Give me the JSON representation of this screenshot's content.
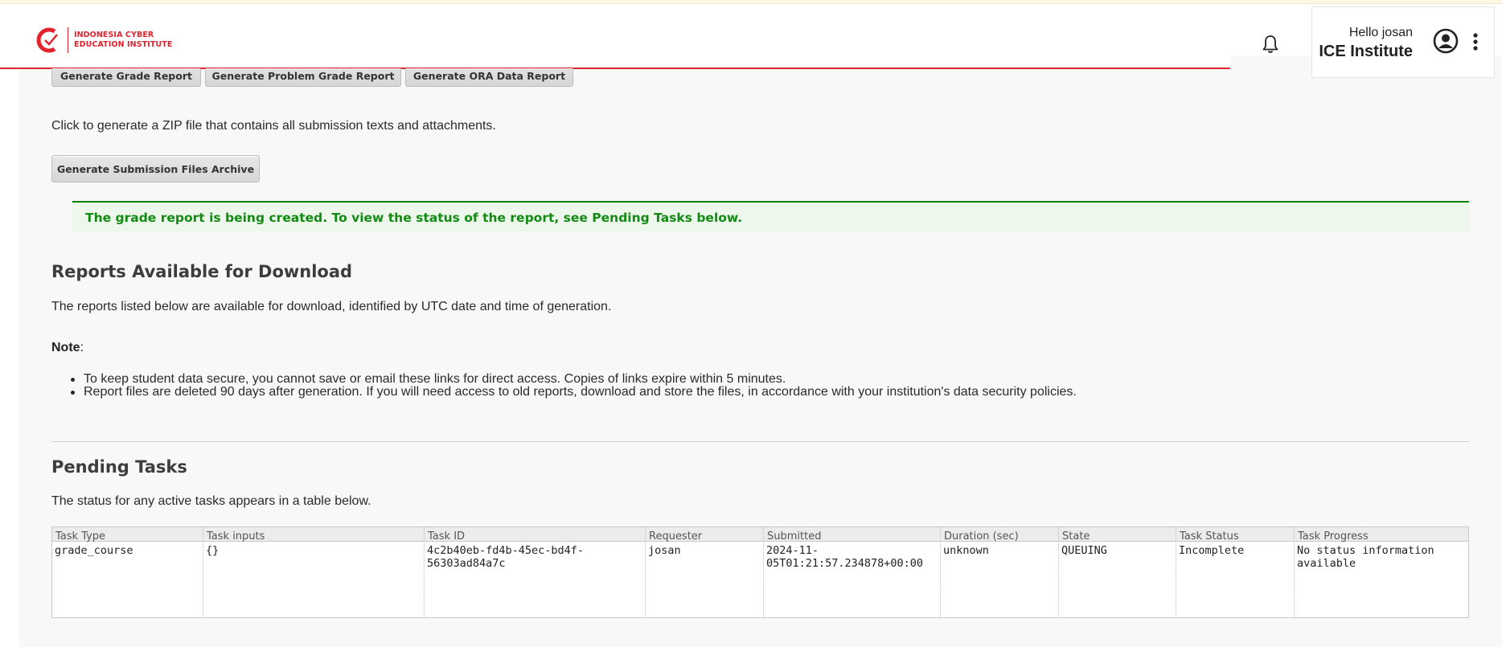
{
  "header": {
    "logo_text_line1": "INDONESIA CYBER",
    "logo_text_line2": "EDUCATION INSTITUTE",
    "greeting": "Hello josan",
    "organization": "ICE Institute"
  },
  "report_buttons": {
    "grade": "Generate Grade Report",
    "problem_grade": "Generate Problem Grade Report",
    "ora_data": "Generate ORA Data Report"
  },
  "submission": {
    "description": "Click to generate a ZIP file that contains all submission texts and attachments.",
    "button": "Generate Submission Files Archive"
  },
  "status_message": "The grade report is being created. To view the status of the report, see Pending Tasks below.",
  "reports": {
    "title": "Reports Available for Download",
    "description": "The reports listed below are available for download, identified by UTC date and time of generation.",
    "note_label": "Note",
    "note_suffix": ":",
    "notes": [
      "To keep student data secure, you cannot save or email these links for direct access. Copies of links expire within 5 minutes.",
      "Report files are deleted 90 days after generation. If you will need access to old reports, download and store the files, in accordance with your institution's data security policies."
    ]
  },
  "pending": {
    "title": "Pending Tasks",
    "description": "The status for any active tasks appears in a table below.",
    "columns": [
      "Task Type",
      "Task inputs",
      "Task ID",
      "Requester",
      "Submitted",
      "Duration (sec)",
      "State",
      "Task Status",
      "Task Progress"
    ],
    "rows": [
      {
        "task_type": "grade_course",
        "task_inputs": "{}",
        "task_id_line1": "4c2b40eb-fd4b-45ec-bd4f-",
        "task_id_line2": "56303ad84a7c",
        "requester": "josan",
        "submitted_line1": "2024-11-",
        "submitted_line2": "05T01:21:57.234878+00:00",
        "duration": "unknown",
        "state": "QUEUING",
        "task_status": "Incomplete",
        "progress_line1": "No status information",
        "progress_line2": "available"
      }
    ]
  },
  "colors": {
    "brand_red": "#e2232e",
    "success_green": "#138a13",
    "success_bg": "#edf7ec"
  }
}
